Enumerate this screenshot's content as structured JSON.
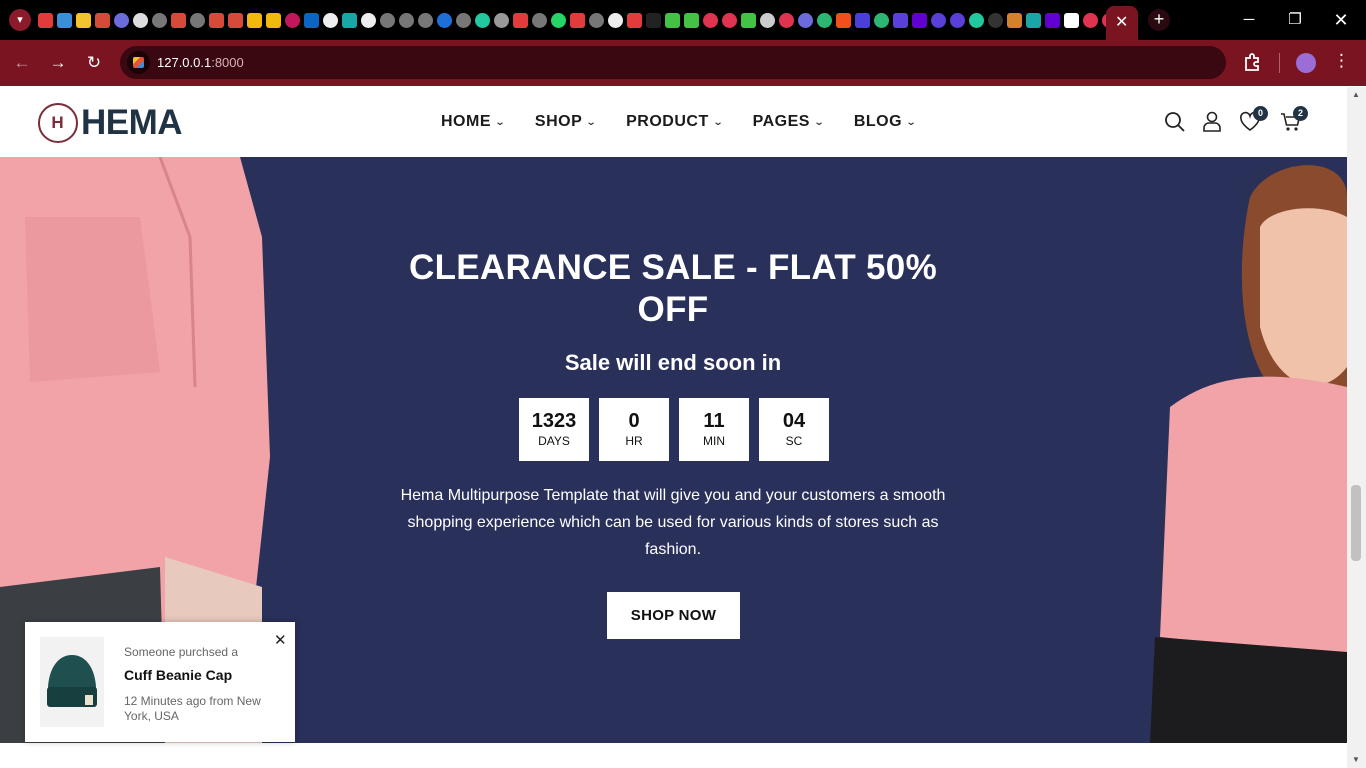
{
  "browser": {
    "url_host": "127.0.0.1",
    "url_port": ":8000",
    "active_tab_close": "✕",
    "new_tab": "+",
    "window_controls": {
      "minimize": "─",
      "maximize": "❐",
      "close": "✕"
    },
    "icons": [
      "tab-search-icon",
      "back-arrow-icon",
      "forward-arrow-icon",
      "reload-icon",
      "extensions-icon",
      "profile-icon",
      "kebab-menu-icon"
    ]
  },
  "header": {
    "logo_mark": "H",
    "logo_text": "HEMA",
    "nav": [
      {
        "label": "HOME"
      },
      {
        "label": "SHOP"
      },
      {
        "label": "PRODUCT"
      },
      {
        "label": "PAGES"
      },
      {
        "label": "BLOG"
      }
    ],
    "wishlist_count": "0",
    "cart_count": "2",
    "icons": [
      "search-icon",
      "user-icon",
      "heart-icon",
      "cart-icon",
      "chevron-down-icon"
    ]
  },
  "hero": {
    "title": "CLEARANCE SALE - FLAT 50% OFF",
    "subtitle": "Sale will end soon in",
    "countdown": [
      {
        "value": "1323",
        "label": "DAYS"
      },
      {
        "value": "0",
        "label": "HR"
      },
      {
        "value": "11",
        "label": "MIN"
      },
      {
        "value": "04",
        "label": "SC"
      }
    ],
    "description": "Hema Multipurpose Template that will give you and your customers a smooth shopping experience which can be used for various kinds of stores such as fashion.",
    "cta": "SHOP NOW",
    "colors": {
      "background": "#29305a",
      "shirt": "#f2a3a8"
    }
  },
  "popup": {
    "line1": "Someone purchsed a",
    "product": "Cuff Beanie Cap",
    "meta": "12 Minutes ago from New York, USA",
    "close": "✕"
  },
  "back_to_top_icon": "arrow-up-icon",
  "accent_color": "#e3596a"
}
